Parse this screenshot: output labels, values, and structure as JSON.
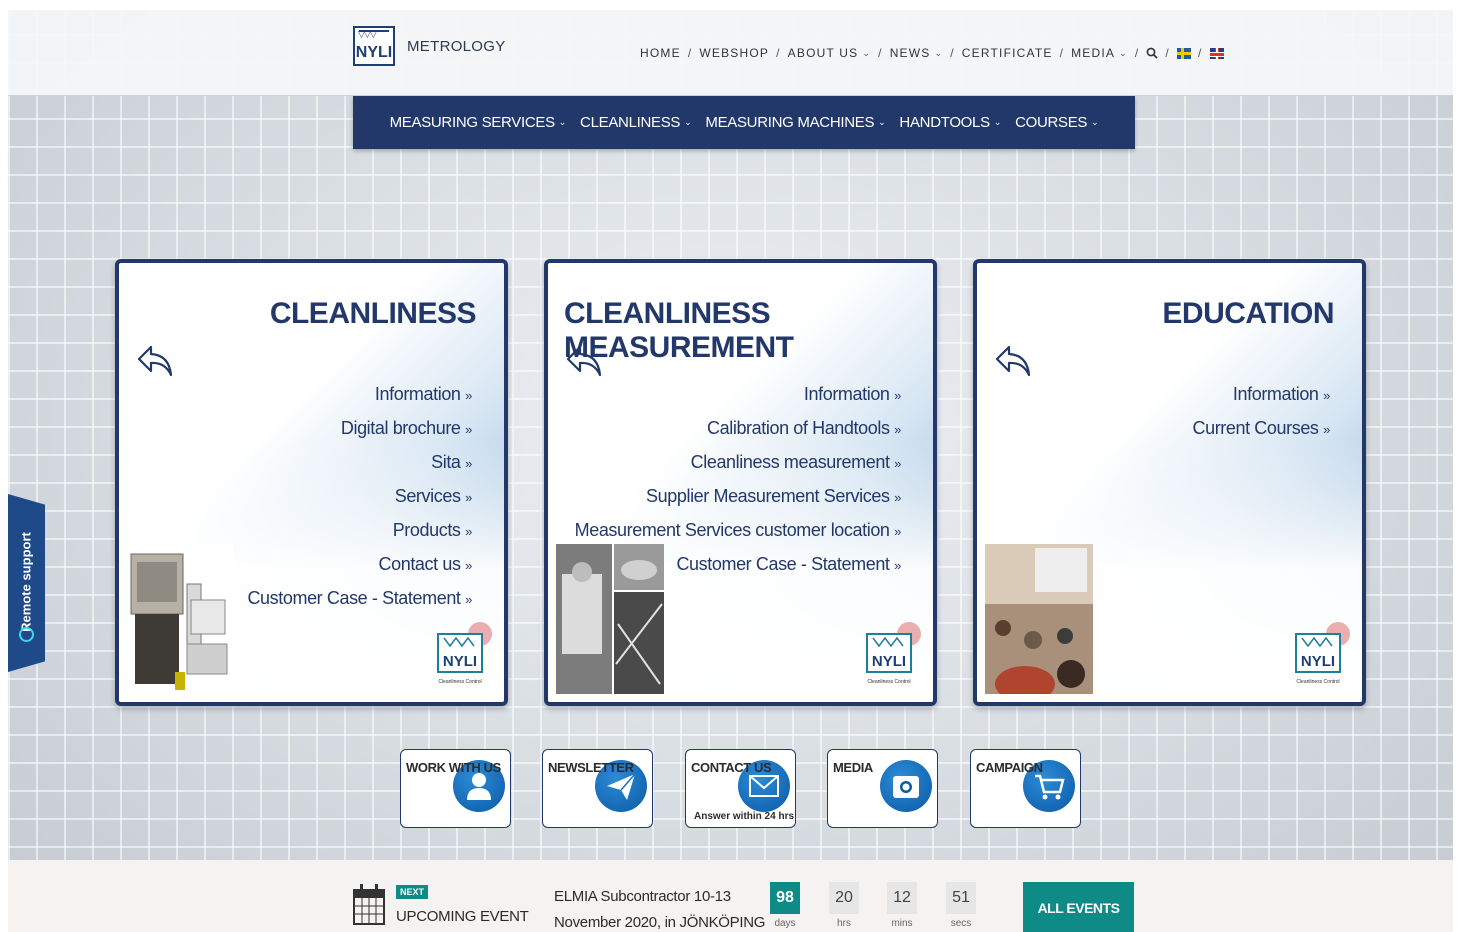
{
  "header": {
    "logo_text": "NYLI",
    "brand": "METROLOGY",
    "nav": [
      {
        "label": "HOME",
        "dropdown": false
      },
      {
        "label": "WEBSHOP",
        "dropdown": false
      },
      {
        "label": "ABOUT US",
        "dropdown": true
      },
      {
        "label": "NEWS",
        "dropdown": true
      },
      {
        "label": "CERTIFICATE",
        "dropdown": false
      },
      {
        "label": "MEDIA",
        "dropdown": true
      }
    ],
    "separator": "/",
    "search_icon": "search-icon",
    "flags": [
      "swedish-flag-icon",
      "uk-flag-icon"
    ]
  },
  "mainnav": [
    {
      "label": "MEASURING SERVICES"
    },
    {
      "label": "CLEANLINESS"
    },
    {
      "label": "MEASURING MACHINES"
    },
    {
      "label": "HANDTOOLS"
    },
    {
      "label": "COURSES"
    }
  ],
  "cards": [
    {
      "title": "CLEANLINESS",
      "links": [
        "Information",
        "Digital brochure",
        "Sita",
        "Services",
        "Products",
        "Contact us",
        "Customer Case - Statement"
      ]
    },
    {
      "title": "CLEANLINESS MEASUREMENT",
      "links": [
        "Information",
        "Calibration of Handtools",
        "Cleanliness measurement",
        "Supplier Measurement Services",
        "Measurement Services customer location",
        "Customer Case - Statement"
      ]
    },
    {
      "title": "EDUCATION",
      "links": [
        "Information",
        "Current Courses"
      ]
    }
  ],
  "link_suffix": "»",
  "card_logo_text": "NYLI",
  "card_logo_sub": "Cleanliness Control",
  "remote_support": "Remote support",
  "quick_buttons": [
    {
      "label": "WORK WITH US",
      "icon": "person-icon",
      "sub": ""
    },
    {
      "label": "NEWSLETTER",
      "icon": "paper-plane-icon",
      "sub": ""
    },
    {
      "label": "CONTACT US",
      "icon": "envelope-icon",
      "sub": "Answer within 24 hrs"
    },
    {
      "label": "MEDIA",
      "icon": "camera-icon",
      "sub": ""
    },
    {
      "label": "CAMPAIGN",
      "icon": "cart-icon",
      "sub": ""
    }
  ],
  "event": {
    "badge": "NEXT",
    "heading": "UPCOMING EVENT",
    "line1": "ELMIA Subcontractor 10-13",
    "line2": "November 2020, in JÖNKÖPING",
    "countdown": [
      {
        "value": "98",
        "unit": "days"
      },
      {
        "value": "20",
        "unit": "hrs"
      },
      {
        "value": "12",
        "unit": "mins"
      },
      {
        "value": "51",
        "unit": "secs"
      }
    ],
    "button": "ALL EVENTS"
  },
  "colors": {
    "navy": "#22386a",
    "teal": "#0e8b86",
    "icon_blue": "#0a5aa6"
  }
}
